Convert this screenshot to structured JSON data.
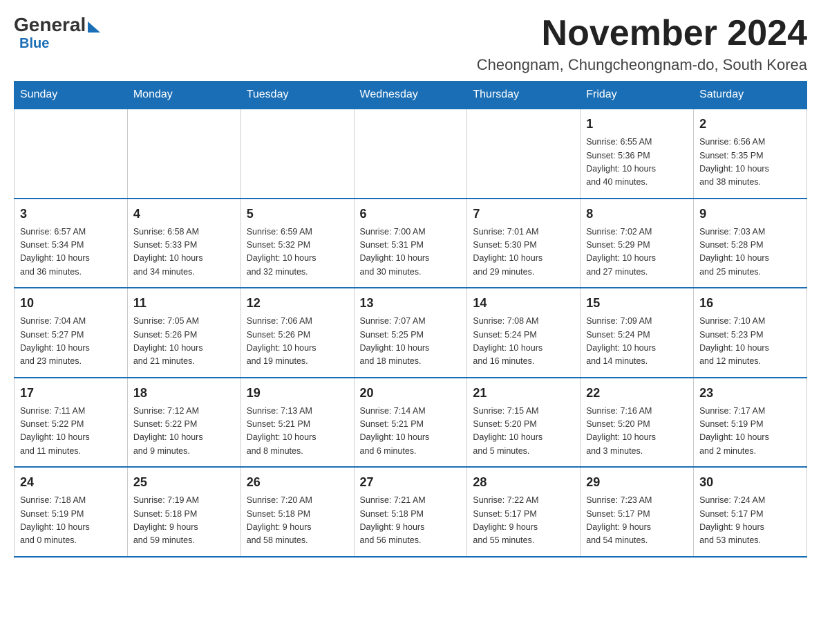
{
  "header": {
    "logo": {
      "general": "General",
      "blue": "Blue",
      "arrow": "▶"
    },
    "title": "November 2024",
    "location": "Cheongnam, Chungcheongnam-do, South Korea"
  },
  "weekdays": [
    "Sunday",
    "Monday",
    "Tuesday",
    "Wednesday",
    "Thursday",
    "Friday",
    "Saturday"
  ],
  "weeks": [
    [
      {
        "day": "",
        "info": ""
      },
      {
        "day": "",
        "info": ""
      },
      {
        "day": "",
        "info": ""
      },
      {
        "day": "",
        "info": ""
      },
      {
        "day": "",
        "info": ""
      },
      {
        "day": "1",
        "info": "Sunrise: 6:55 AM\nSunset: 5:36 PM\nDaylight: 10 hours\nand 40 minutes."
      },
      {
        "day": "2",
        "info": "Sunrise: 6:56 AM\nSunset: 5:35 PM\nDaylight: 10 hours\nand 38 minutes."
      }
    ],
    [
      {
        "day": "3",
        "info": "Sunrise: 6:57 AM\nSunset: 5:34 PM\nDaylight: 10 hours\nand 36 minutes."
      },
      {
        "day": "4",
        "info": "Sunrise: 6:58 AM\nSunset: 5:33 PM\nDaylight: 10 hours\nand 34 minutes."
      },
      {
        "day": "5",
        "info": "Sunrise: 6:59 AM\nSunset: 5:32 PM\nDaylight: 10 hours\nand 32 minutes."
      },
      {
        "day": "6",
        "info": "Sunrise: 7:00 AM\nSunset: 5:31 PM\nDaylight: 10 hours\nand 30 minutes."
      },
      {
        "day": "7",
        "info": "Sunrise: 7:01 AM\nSunset: 5:30 PM\nDaylight: 10 hours\nand 29 minutes."
      },
      {
        "day": "8",
        "info": "Sunrise: 7:02 AM\nSunset: 5:29 PM\nDaylight: 10 hours\nand 27 minutes."
      },
      {
        "day": "9",
        "info": "Sunrise: 7:03 AM\nSunset: 5:28 PM\nDaylight: 10 hours\nand 25 minutes."
      }
    ],
    [
      {
        "day": "10",
        "info": "Sunrise: 7:04 AM\nSunset: 5:27 PM\nDaylight: 10 hours\nand 23 minutes."
      },
      {
        "day": "11",
        "info": "Sunrise: 7:05 AM\nSunset: 5:26 PM\nDaylight: 10 hours\nand 21 minutes."
      },
      {
        "day": "12",
        "info": "Sunrise: 7:06 AM\nSunset: 5:26 PM\nDaylight: 10 hours\nand 19 minutes."
      },
      {
        "day": "13",
        "info": "Sunrise: 7:07 AM\nSunset: 5:25 PM\nDaylight: 10 hours\nand 18 minutes."
      },
      {
        "day": "14",
        "info": "Sunrise: 7:08 AM\nSunset: 5:24 PM\nDaylight: 10 hours\nand 16 minutes."
      },
      {
        "day": "15",
        "info": "Sunrise: 7:09 AM\nSunset: 5:24 PM\nDaylight: 10 hours\nand 14 minutes."
      },
      {
        "day": "16",
        "info": "Sunrise: 7:10 AM\nSunset: 5:23 PM\nDaylight: 10 hours\nand 12 minutes."
      }
    ],
    [
      {
        "day": "17",
        "info": "Sunrise: 7:11 AM\nSunset: 5:22 PM\nDaylight: 10 hours\nand 11 minutes."
      },
      {
        "day": "18",
        "info": "Sunrise: 7:12 AM\nSunset: 5:22 PM\nDaylight: 10 hours\nand 9 minutes."
      },
      {
        "day": "19",
        "info": "Sunrise: 7:13 AM\nSunset: 5:21 PM\nDaylight: 10 hours\nand 8 minutes."
      },
      {
        "day": "20",
        "info": "Sunrise: 7:14 AM\nSunset: 5:21 PM\nDaylight: 10 hours\nand 6 minutes."
      },
      {
        "day": "21",
        "info": "Sunrise: 7:15 AM\nSunset: 5:20 PM\nDaylight: 10 hours\nand 5 minutes."
      },
      {
        "day": "22",
        "info": "Sunrise: 7:16 AM\nSunset: 5:20 PM\nDaylight: 10 hours\nand 3 minutes."
      },
      {
        "day": "23",
        "info": "Sunrise: 7:17 AM\nSunset: 5:19 PM\nDaylight: 10 hours\nand 2 minutes."
      }
    ],
    [
      {
        "day": "24",
        "info": "Sunrise: 7:18 AM\nSunset: 5:19 PM\nDaylight: 10 hours\nand 0 minutes."
      },
      {
        "day": "25",
        "info": "Sunrise: 7:19 AM\nSunset: 5:18 PM\nDaylight: 9 hours\nand 59 minutes."
      },
      {
        "day": "26",
        "info": "Sunrise: 7:20 AM\nSunset: 5:18 PM\nDaylight: 9 hours\nand 58 minutes."
      },
      {
        "day": "27",
        "info": "Sunrise: 7:21 AM\nSunset: 5:18 PM\nDaylight: 9 hours\nand 56 minutes."
      },
      {
        "day": "28",
        "info": "Sunrise: 7:22 AM\nSunset: 5:17 PM\nDaylight: 9 hours\nand 55 minutes."
      },
      {
        "day": "29",
        "info": "Sunrise: 7:23 AM\nSunset: 5:17 PM\nDaylight: 9 hours\nand 54 minutes."
      },
      {
        "day": "30",
        "info": "Sunrise: 7:24 AM\nSunset: 5:17 PM\nDaylight: 9 hours\nand 53 minutes."
      }
    ]
  ]
}
